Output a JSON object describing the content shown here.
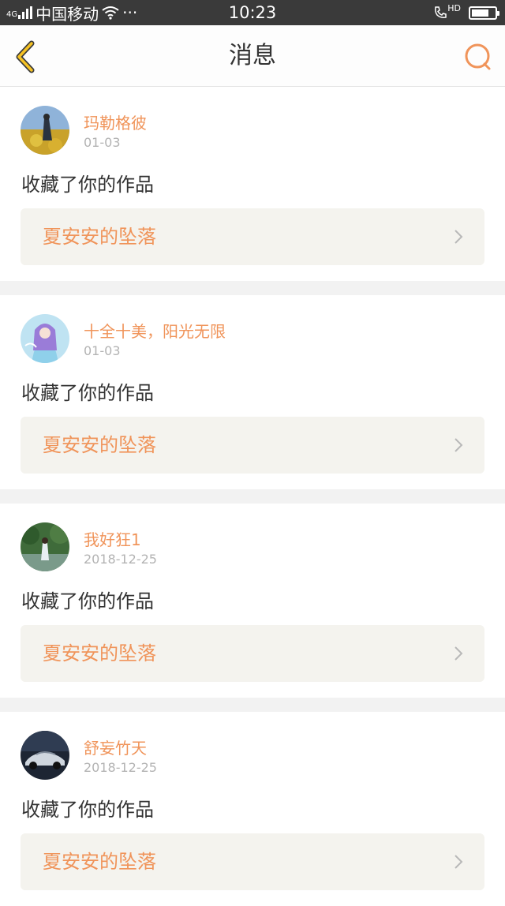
{
  "status_bar": {
    "network": "4G",
    "carrier": "中国移动",
    "more": "···",
    "time": "10:23",
    "hd_label": "HD",
    "icons": [
      "signal-icon",
      "wifi-icon",
      "hd-call-icon",
      "battery-icon"
    ]
  },
  "header": {
    "title": "消息",
    "back_icon": "chevron-left-icon",
    "search_icon": "search-icon"
  },
  "colors": {
    "accent": "#f0945a",
    "back_yellow": "#f5c224",
    "text": "#333333",
    "muted": "#b3b3b3",
    "card_bg": "#f4f3ee",
    "divider": "#f2f2f2"
  },
  "messages": [
    {
      "username": "玛勒格彼",
      "date": "01-03",
      "action": "收藏了你的作品",
      "work_title": "夏安安的坠落"
    },
    {
      "username": "十全十美，阳光无限",
      "date": "01-03",
      "action": "收藏了你的作品",
      "work_title": "夏安安的坠落"
    },
    {
      "username": "我好狂1",
      "date": "2018-12-25",
      "action": "收藏了你的作品",
      "work_title": "夏安安的坠落"
    },
    {
      "username": "舒妄竹天",
      "date": "2018-12-25",
      "action": "收藏了你的作品",
      "work_title": "夏安安的坠落"
    }
  ]
}
